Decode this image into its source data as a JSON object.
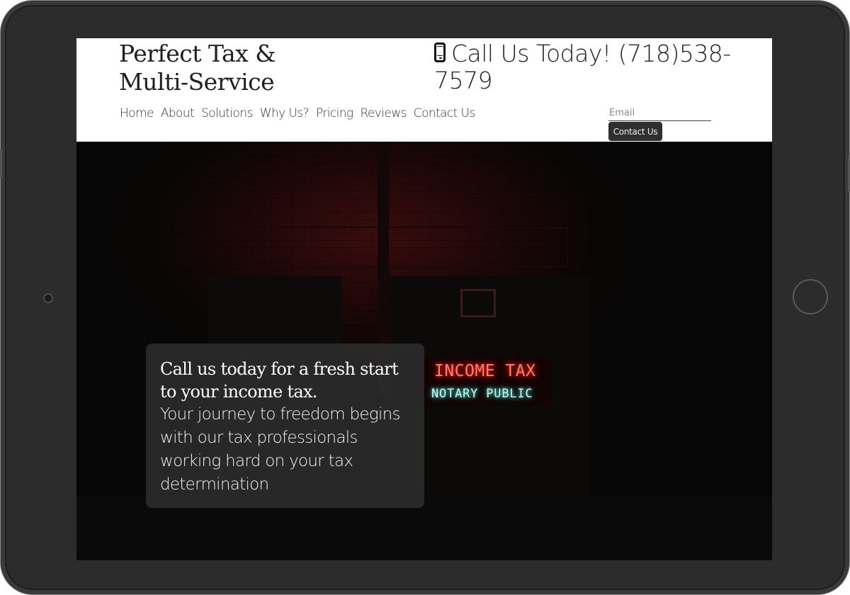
{
  "site": {
    "brand_line1": "Perfect Tax &",
    "brand_line2": "Multi-Service",
    "phone_text": "Call Us Today! (718)538-7579"
  },
  "nav": {
    "items": [
      "Home",
      "About",
      "Solutions",
      "Why Us?",
      "Pricing",
      "Reviews",
      "Contact Us"
    ]
  },
  "signup": {
    "email_placeholder": "Email",
    "email_value": "",
    "button_label": "Contact Us"
  },
  "hero": {
    "sign_line1": "INCOME TAX",
    "sign_line2": "NOTARY PUBLIC",
    "callout_headline": "Call us today for a fresh start to your income tax.",
    "callout_body": "Your journey to freedom begins with our tax professionals working hard on your tax determination"
  },
  "colors": {
    "device_frame": "#2c2c2c",
    "header_bg": "#ffffff",
    "button_bg": "#2f2f2f",
    "neon_red": "#ff7a6e",
    "neon_teal": "#c9f5ef"
  },
  "icons": {
    "phone": "mobile-phone-icon",
    "camera": "front-camera-icon",
    "home": "home-button-icon"
  }
}
